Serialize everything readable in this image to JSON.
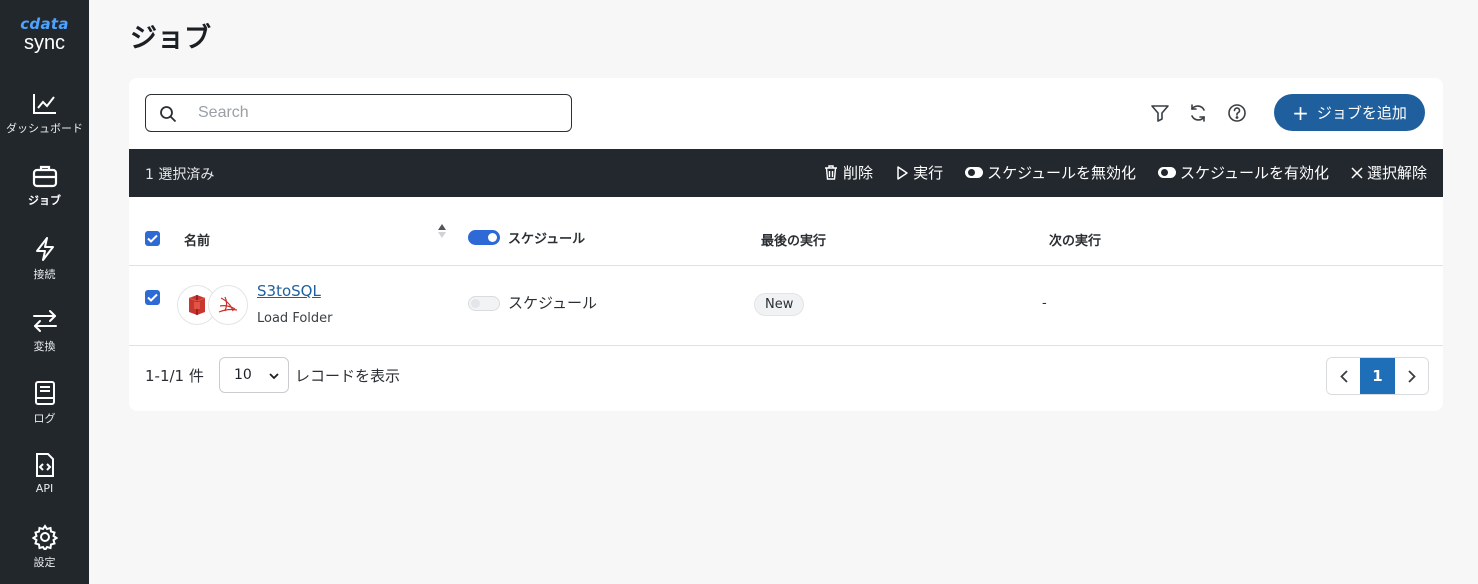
{
  "sidebar": {
    "logo_brand": "cdata",
    "logo_product": "sync",
    "items": [
      {
        "label": "ダッシュボード",
        "icon": "chart-line-icon"
      },
      {
        "label": "ジョブ",
        "icon": "briefcase-icon",
        "active": true
      },
      {
        "label": "接続",
        "icon": "lightning-icon"
      },
      {
        "label": "変換",
        "icon": "arrows-swap-icon"
      },
      {
        "label": "ログ",
        "icon": "book-icon"
      },
      {
        "label": "API",
        "icon": "code-file-icon"
      },
      {
        "label": "設定",
        "icon": "gear-icon"
      }
    ]
  },
  "page": {
    "title": "ジョブ"
  },
  "toolbar": {
    "search_placeholder": "Search",
    "search_value": "",
    "add_button": "ジョブを追加",
    "icons": [
      "filter-icon",
      "refresh-icon",
      "help-icon"
    ]
  },
  "selection_bar": {
    "count": "1 選択済み",
    "actions": {
      "delete": "削除",
      "run": "実行",
      "disable_schedule": "スケジュールを無効化",
      "enable_schedule": "スケジュールを有効化",
      "deselect": "選択解除"
    }
  },
  "table": {
    "headers": {
      "name": "名前",
      "schedule": "スケジュール",
      "last_run": "最後の実行",
      "next_run": "次の実行"
    },
    "rows": [
      {
        "checked": true,
        "name": "S3toSQL",
        "subtitle": "Load Folder",
        "source_icon": "amazon-s3-icon",
        "destination_icon": "sql-server-icon",
        "schedule_enabled": false,
        "schedule_label": "スケジュール",
        "last_run": "New",
        "next_run": "-"
      }
    ]
  },
  "footer": {
    "count": "1-1/1 件",
    "page_size": "10",
    "page_size_label": "レコードを表示",
    "current_page": "1"
  },
  "colors": {
    "sidebar_bg": "#22272b",
    "accent": "#1f5f9e",
    "checkbox": "#2d6ad6",
    "selection_bar_bg": "#22282d"
  }
}
